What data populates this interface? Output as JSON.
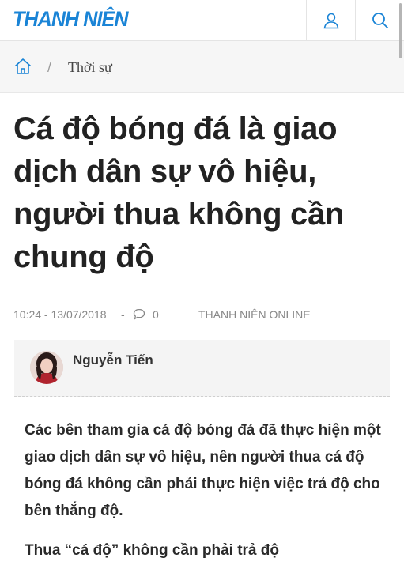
{
  "header": {
    "logo_text": "THANH NIÊN",
    "brand_color": "#1a84d6",
    "user_icon": "user-icon",
    "search_icon": "search-icon"
  },
  "breadcrumb": {
    "home_icon": "home-icon",
    "separator": "/",
    "category": "Thời sự"
  },
  "article": {
    "title": "Cá độ bóng đá là giao dịch dân sự vô hiệu, người thua không cần chung độ",
    "meta": {
      "datetime": "10:24 - 13/07/2018",
      "dash": "-",
      "comment_icon": "comment-icon",
      "comment_count": "0",
      "source": "THANH NIÊN ONLINE"
    },
    "author": {
      "name": "Nguyễn Tiến"
    },
    "sapo": "Các bên tham gia cá độ bóng đá đã thực hiện một giao dịch dân sự vô hiệu, nên người thua cá độ bóng đá không cần phải thực hiện việc trả độ cho bên thắng độ.",
    "subheading": "Thua “cá độ” không cần phải trả độ"
  }
}
